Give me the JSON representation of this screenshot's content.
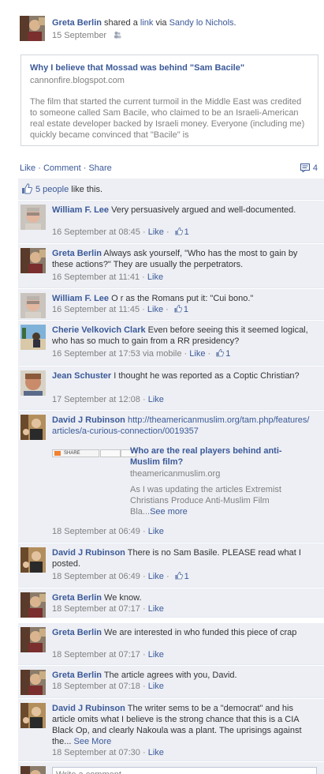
{
  "story": {
    "author": "Greta Berlin",
    "shared_text": " shared a ",
    "link_word": "link",
    "via_text": " via ",
    "via_name": "Sandy lo Nichols",
    "period": ".",
    "date": "15 September",
    "privacy_icon": "friends-icon"
  },
  "link_box": {
    "title": "Why I believe that Mossad was behind \"Sam Bacile\"",
    "domain": "cannonfire.blogspot.com",
    "description": "The film that started the current turmoil in the Middle East was credited to someone called Sam Bacile, who claimed to be an Israeli-American real estate developer backed by Israeli money. Everyone (including me) quickly became convinced that \"Bacile\" is"
  },
  "actions": {
    "like": "Like",
    "comment": "Comment",
    "share": "Share",
    "dot": " · ",
    "comment_count": "4"
  },
  "likes": {
    "count_text": "5 people",
    "suffix": " like this."
  },
  "comments": [
    {
      "author": "William F. Lee",
      "text": " Very persuasively argued and well-documented.",
      "time": "16 September at 08:45",
      "like_label": "Like",
      "likes": "1"
    },
    {
      "author": "Greta Berlin",
      "text": " Always ask yourself, \"Who has the most to gain by these actions?\" They are usually the perpetrators.",
      "time": "16 September at 11:41",
      "like_label": "Like"
    },
    {
      "author": "William F. Lee",
      "text": " O r as the Romans put it: \"Cui bono.\"",
      "time": "16 September at 11:45",
      "like_label": "Like",
      "likes": "1"
    },
    {
      "author": "Cherie Velkovich Clark",
      "text": " Even before seeing this it seemed logical, who has so much to gain from a RR presidency?",
      "time": "16 September at 17:53 via mobile",
      "like_label": "Like",
      "likes": "1"
    },
    {
      "author": "Jean Schuster",
      "text": " I thought he was reported as a Coptic Christian?",
      "time": "17 September at 12:08",
      "like_label": "Like"
    },
    {
      "author": "David J Rubinson",
      "url": "http://theamericanmuslim.org/tam.php/features/articles/a-curious-connection/0019357",
      "share_label": "SHARE",
      "preview_title": "Who are the real players behind anti-Muslim film?",
      "preview_domain": "theamericanmuslim.org",
      "preview_desc": "As I was updating the articles Extremist Christians Produce Anti-Muslim Film Bla...",
      "see_more": "See more",
      "time": "18 September at 06:49",
      "like_label": "Like"
    },
    {
      "author": "David J Rubinson",
      "text": " There is no Sam Basile. PLEASE read what I posted.",
      "time": "18 September at 06:49",
      "like_label": "Like",
      "likes": "1"
    },
    {
      "author": "Greta Berlin",
      "text": " We know.",
      "time": "18 September at 07:17",
      "like_label": "Like"
    },
    {
      "author": "Greta Berlin",
      "text": " We are interested in who funded this piece of crap",
      "time": "18 September at 07:17",
      "like_label": "Like"
    },
    {
      "author": "Greta Berlin",
      "text": " The article agrees with you, David.",
      "time": "18 September at 07:18",
      "like_label": "Like"
    },
    {
      "author": "David J Rubinson",
      "text": " The writer sems to be a \"democrat\" and his article omits what I believe is the strong chance that this is a CIA Black Op, and clearly Nakoula was a plant. The uprisings against the...",
      "see_more": "See More",
      "time": "18 September at 07:30",
      "like_label": "Like"
    }
  ],
  "write_comment": {
    "placeholder": "Write a comment..."
  },
  "colors": {
    "link": "#3b5998",
    "ufi_bg": "#edeff4",
    "meta": "#808080"
  }
}
